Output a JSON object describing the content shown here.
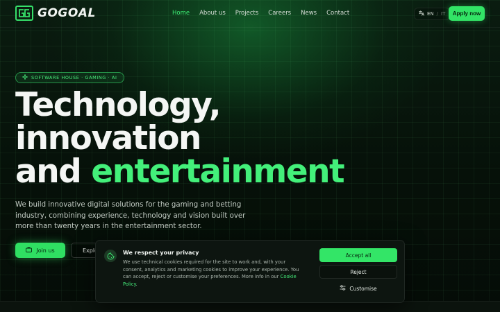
{
  "brand": {
    "name": "GOGOAL",
    "logo_icon": "gg-logo-icon",
    "accent": "#36e06a"
  },
  "nav": {
    "items": [
      {
        "label": "Home",
        "active": true
      },
      {
        "label": "About us",
        "active": false
      },
      {
        "label": "Projects",
        "active": false
      },
      {
        "label": "Careers",
        "active": false
      },
      {
        "label": "News",
        "active": false
      },
      {
        "label": "Contact",
        "active": false
      }
    ]
  },
  "lang": {
    "current": "EN",
    "separator": "/",
    "other": "IT",
    "icon": "translate-icon"
  },
  "header": {
    "apply_label": "Apply now"
  },
  "hero": {
    "badge": "SOFTWARE HOUSE · GAMING · AI",
    "title_line1": "Technology,",
    "title_line2": "innovation",
    "title_line3_prefix": "and ",
    "title_line3_accent": "entertainment",
    "subtitle": "We build innovative digital solutions for the gaming and betting industry, combining experience, technology and vision built over more than twenty years in the entertainment sector.",
    "join_label": "Join us",
    "explore_label": "Explo"
  },
  "cookie": {
    "title": "We respect your privacy",
    "text": "We use technical cookies required for the site to work and, with your consent, analytics and marketing cookies to improve your experience. You can accept, reject or customise your preferences. More info in our ",
    "link": "Cookie Policy",
    "text_end": ".",
    "accept_label": "Accept all",
    "reject_label": "Reject",
    "customise_label": "Customise"
  }
}
